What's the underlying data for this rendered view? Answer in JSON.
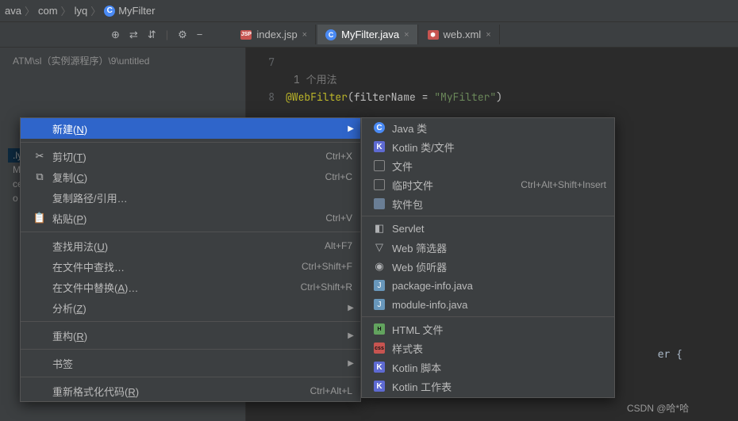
{
  "breadcrumb": {
    "ava": "ava",
    "com": "com",
    "lyq": "lyq",
    "current": "MyFilter"
  },
  "tabs": {
    "t1": "index.jsp",
    "t2": "MyFilter.java",
    "t3": "web.xml"
  },
  "project": {
    "path": "ATM\\sl（实例源程序）\\9\\untitled",
    "n1": ".lyq",
    "n2": "MyF",
    "n3": "ces",
    "n4": "o"
  },
  "code": {
    "ln7": "7",
    "ln8": "8",
    "usage": "1 个用法",
    "anno": "@WebFilter",
    "paren": "(filterName = ",
    "str": "\"MyFilter\"",
    "close": ")",
    "frag": "er {"
  },
  "ctx1": {
    "new": "新建",
    "new_m": "N",
    "cut": "剪切",
    "cut_m": "T",
    "cut_s": "Ctrl+X",
    "copy": "复制",
    "copy_m": "C",
    "copy_s": "Ctrl+C",
    "copyref": "复制路径/引用…",
    "paste": "粘贴",
    "paste_m": "P",
    "paste_s": "Ctrl+V",
    "findus": "查找用法",
    "findus_m": "U",
    "findus_s": "Alt+F7",
    "findin": "在文件中查找…",
    "findin_s": "Ctrl+Shift+F",
    "replin": "在文件中替换",
    "replin_m": "A",
    "replin_suf": "…",
    "replin_s": "Ctrl+Shift+R",
    "analyze": "分析",
    "analyze_m": "Z",
    "refactor": "重构",
    "refactor_m": "R",
    "bookmark": "书签",
    "reformat": "重新格式化代码",
    "reformat_m": "R",
    "reformat_s": "Ctrl+Alt+L"
  },
  "ctx2": {
    "javaclass": "Java 类",
    "kotlinclass": "Kotlin 类/文件",
    "file": "文件",
    "scratch": "临时文件",
    "scratch_s": "Ctrl+Alt+Shift+Insert",
    "package": "软件包",
    "servlet": "Servlet",
    "webfilter": "Web 筛选器",
    "weblistener": "Web 侦听器",
    "pkginfo": "package-info.java",
    "modinfo": "module-info.java",
    "htmlfile": "HTML 文件",
    "stylesheet": "样式表",
    "kotlinscript": "Kotlin 脚本",
    "kotlinws": "Kotlin 工作表"
  },
  "toolbar_icons": {
    "target": "⊕",
    "collapse": "⇄",
    "expand": "⇵",
    "settings": "⚙",
    "minimize": "−"
  },
  "watermark": "CSDN @哈*哈"
}
